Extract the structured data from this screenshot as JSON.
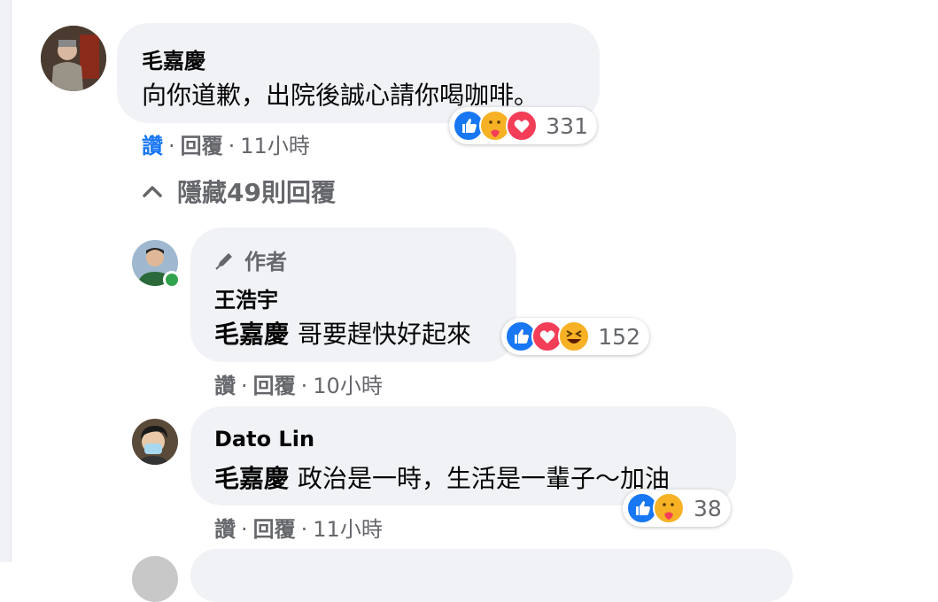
{
  "comments": [
    {
      "author": "毛嘉慶",
      "text": "向你道歉，出院後誠心請你喝咖啡。",
      "reaction_count": "331",
      "reaction_icons": [
        "like-icon",
        "care-icon",
        "love-icon"
      ],
      "actions": {
        "like": "讚",
        "reply": "回覆",
        "time": "11小時"
      }
    }
  ],
  "toggle_replies": "隱藏49則回覆",
  "replies": [
    {
      "badge": "作者",
      "author": "王浩宇",
      "mention": "毛嘉慶",
      "text": "哥要趕快好起來",
      "reaction_count": "152",
      "reaction_icons": [
        "like-icon",
        "love-icon",
        "haha-icon"
      ],
      "actions": {
        "like": "讚",
        "reply": "回覆",
        "time": "10小時"
      }
    },
    {
      "author": "Dato Lin",
      "mention": "毛嘉慶",
      "text": "政治是一時，生活是一輩子～加油",
      "reaction_count": "38",
      "reaction_icons": [
        "like-icon",
        "care-icon"
      ],
      "actions": {
        "like": "讚",
        "reply": "回覆",
        "time": "11小時"
      }
    }
  ],
  "colors": {
    "bubble": "#f0f2f5",
    "like_blue": "#1877f2",
    "meta_gray": "#65676b",
    "online_green": "#31a24c"
  }
}
